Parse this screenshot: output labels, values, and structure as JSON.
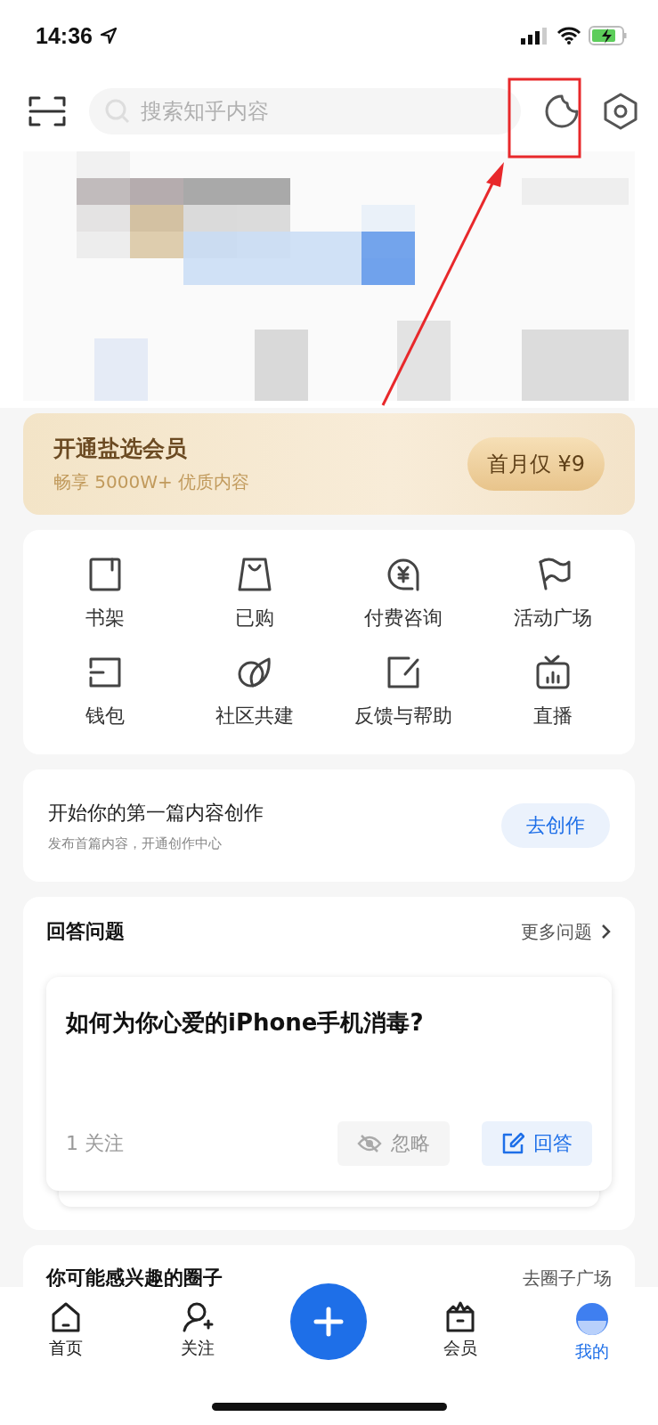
{
  "status_bar": {
    "time": "14:36"
  },
  "top_bar": {
    "search": {
      "placeholder": "搜索知乎内容"
    }
  },
  "member_banner": {
    "title": "开通盐选会员",
    "subtitle": "畅享 5000W+ 优质内容",
    "button": "首月仅 ¥9"
  },
  "shortcuts": [
    {
      "label": "书架"
    },
    {
      "label": "已购"
    },
    {
      "label": "付费咨询"
    },
    {
      "label": "活动广场"
    },
    {
      "label": "钱包"
    },
    {
      "label": "社区共建"
    },
    {
      "label": "反馈与帮助"
    },
    {
      "label": "直播"
    }
  ],
  "creation": {
    "title": "开始你的第一篇内容创作",
    "subtitle": "发布首篇内容，开通创作中心",
    "button": "去创作"
  },
  "answer_section": {
    "title": "回答问题",
    "more_link": "更多问题",
    "question": {
      "title": "如何为你心爱的iPhone手机消毒?",
      "followers": "1 关注",
      "ignore_button": "忽略",
      "answer_button": "回答"
    }
  },
  "circles_section": {
    "title": "你可能感兴趣的圈子",
    "link": "去圈子广场"
  },
  "tab_bar": {
    "tabs": [
      {
        "label": "首页",
        "selected": false
      },
      {
        "label": "关注",
        "selected": false
      },
      {
        "label": "会员",
        "selected": false
      },
      {
        "label": "我的",
        "selected": true
      }
    ],
    "compose": {
      "kind": "plus"
    }
  },
  "annotation": {
    "kind": "box_arrow"
  }
}
